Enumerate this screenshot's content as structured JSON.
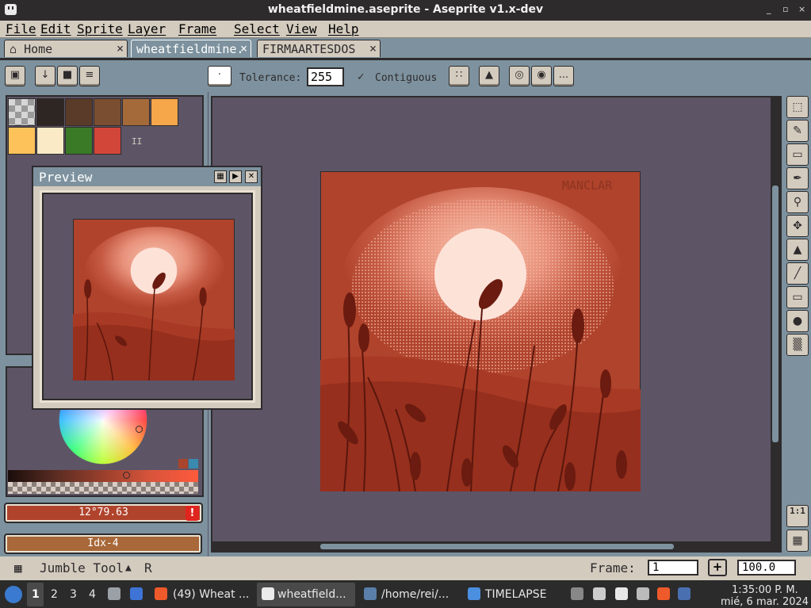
{
  "window": {
    "title": "wheatfieldmine.aseprite - Aseprite v1.x-dev",
    "buttons": [
      "_",
      "▫",
      "×"
    ]
  },
  "menu": [
    "File",
    "Edit",
    "Sprite",
    "Layer",
    "Frame",
    "Select",
    "View",
    "Help"
  ],
  "tabs": [
    {
      "label": "Home",
      "close": "×"
    },
    {
      "label": "wheatfieldmine.",
      "close": "×"
    },
    {
      "label": "FIRMAARTESDOS",
      "close": "×"
    }
  ],
  "toolbar": {
    "tolerance_label": "Tolerance:",
    "tolerance_value": "255",
    "contiguous_label": "Contiguous",
    "contiguous_checked": "✓",
    "more_label": "..."
  },
  "palette": {
    "colors": [
      "#2e2622",
      "#5a3a28",
      "#7a4e30",
      "#a56a3a",
      "#f5a74a",
      "#fdc35a",
      "#fbeac6",
      "#3a7a26",
      "#d2463a"
    ],
    "page_marker": "II"
  },
  "preview": {
    "title": "Preview"
  },
  "color_bars": {
    "fg": "12°79.63",
    "bg": "Idx-4",
    "fg_color": "#b0432c",
    "bg_color": "#a8683a",
    "warning": "!"
  },
  "canvas": {
    "watermark": "MANCLAR"
  },
  "status": {
    "tool": "Jumble Tool",
    "shortcut": "R",
    "frame_label": "Frame:",
    "frame_value": "1",
    "add_frame": "+",
    "zoom": "100.0"
  },
  "right_tools": [
    "marquee-tool",
    "pencil-tool",
    "eraser-tool",
    "eyedropper-tool",
    "zoom-tool",
    "move-tool",
    "paint-bucket-tool",
    "line-tool",
    "rectangle-tool",
    "blur-tool",
    "jumble-tool"
  ],
  "right_bottom": {
    "zoom_1to1": "1:1"
  },
  "taskbar": {
    "workspaces": [
      "1",
      "2",
      "3",
      "4"
    ],
    "windows": [
      "(49) Wheat ...",
      "wheatfield...",
      "/home/rei/...",
      "TIMELAPSE"
    ],
    "time": "1:35:00 P. M.",
    "date": "mié, 6 mar. 2024"
  }
}
